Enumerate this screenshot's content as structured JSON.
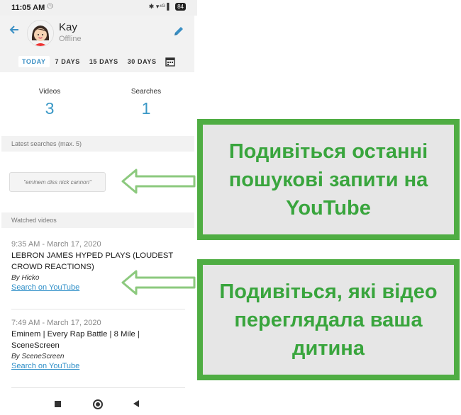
{
  "status_bar": {
    "time": "11:05 AM",
    "left_icons": "⌖ ◷",
    "right_icons": "✱ ▾⁴ᴳ ▌",
    "battery": "84"
  },
  "header": {
    "name": "Kay",
    "presence": "Offline",
    "ranges": [
      "TODAY",
      "7 DAYS",
      "15 DAYS",
      "30 DAYS"
    ],
    "active_range": "TODAY"
  },
  "stats": {
    "videos_label": "Videos",
    "videos_value": "3",
    "searches_label": "Searches",
    "searches_value": "1"
  },
  "latest_searches": {
    "title": "Latest searches (max. 5)",
    "items": [
      "\"eminem diss nick cannon\""
    ]
  },
  "watched_videos": {
    "title": "Watched videos",
    "items": [
      {
        "time": "9:35 AM - March 17, 2020",
        "title": "LEBRON JAMES HYPED PLAYS (LOUDEST CROWD REACTIONS)",
        "by": "By Hicko",
        "link": "Search on YouTube"
      },
      {
        "time": "7:49 AM - March 17, 2020",
        "title": "Eminem | Every Rap Battle | 8 Mile | SceneScreen",
        "by": "By SceneScreen",
        "link": "Search on YouTube"
      }
    ]
  },
  "callouts": [
    {
      "text": "Подивіться останні пошукові запити на YouTube"
    },
    {
      "text": "Подивіться, які відео переглядала ваша дитина"
    }
  ],
  "colors": {
    "accent": "#3a98c6",
    "callout_green": "#4fad43",
    "callout_bg": "#e6e6e6"
  }
}
